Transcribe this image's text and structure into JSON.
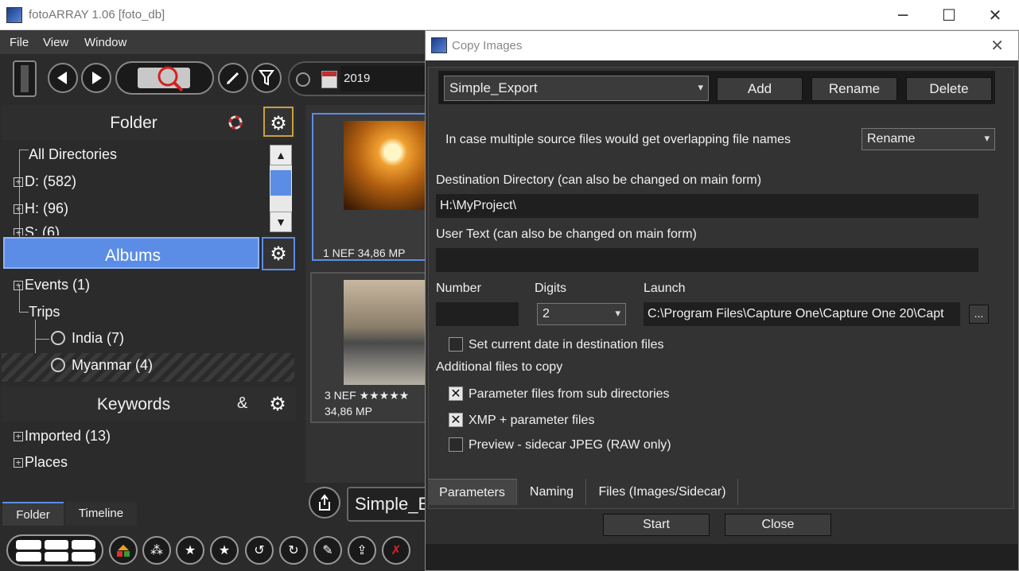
{
  "window": {
    "title": "fotoARRAY 1.06 [foto_db]",
    "controls": [
      "─",
      "☐",
      "✕"
    ]
  },
  "menu": [
    "File",
    "View",
    "Window"
  ],
  "toolbar": {
    "date_value": "2019"
  },
  "left": {
    "folder_header": "Folder",
    "folder_items": [
      "All Directories",
      "D: (582)",
      "H: (96)",
      "S: (6)"
    ],
    "albums_header": "Albums",
    "album_items": [
      "Events (1)",
      "Trips",
      "India (7)",
      "Myanmar (4)"
    ],
    "keywords_header": "Keywords",
    "keywords_symbol": "&",
    "keyword_items": [
      "Imported (13)",
      "Places"
    ],
    "tabs": [
      "Folder",
      "Timeline"
    ]
  },
  "thumbs": {
    "t1_info": "1   NEF 34,86 MP",
    "t3_info_line1": "3   NEF ★★★★★",
    "t3_info_line2": "34,86 MP",
    "export_label": "Simple_E"
  },
  "dialog": {
    "title": "Copy Images",
    "preset": "Simple_Export",
    "btn_add": "Add",
    "btn_rename": "Rename",
    "btn_delete": "Delete",
    "overlap_label": "In case multiple source files would get overlapping file names",
    "overlap_value": "Rename",
    "dest_label": "Destination Directory (can also be changed on main form)",
    "dest_value": "H:\\MyProject\\",
    "usertext_label": "User Text (can also be changed on main form)",
    "usertext_value": "",
    "number_label": "Number",
    "digits_label": "Digits",
    "launch_label": "Launch",
    "number_value": "",
    "digits_value": "2",
    "launch_value": "C:\\Program Files\\Capture One\\Capture One 20\\Capt",
    "browse_label": "...",
    "set_date_label": "Set current date in destination files",
    "additional_label": "Additional files to copy",
    "opt_param_label": "Parameter files from sub directories",
    "opt_xmp_label": "XMP + parameter files",
    "opt_preview_label": "Preview - sidecar JPEG (RAW only)",
    "tabs": [
      "Parameters",
      "Naming",
      "Files (Images/Sidecar)"
    ],
    "start_label": "Start",
    "close_label": "Close"
  },
  "colors": {
    "accent": "#5b8de6",
    "panel": "#2b2b2b",
    "highlight_border": "#c8a040"
  }
}
